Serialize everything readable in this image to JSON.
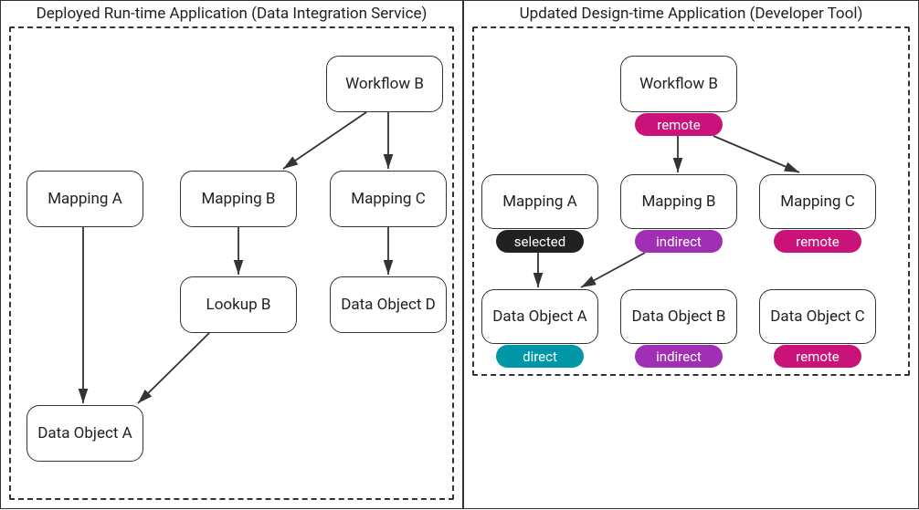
{
  "left": {
    "title": "Deployed Run-time Application (Data Integration Service)",
    "nodes": {
      "workflowB": "Workflow B",
      "mappingA": "Mapping A",
      "mappingB": "Mapping B",
      "mappingC": "Mapping C",
      "lookupB": "Lookup B",
      "dataObjectD": "Data Object D",
      "dataObjectA": "Data Object A"
    }
  },
  "right": {
    "title": "Updated Design-time Application (Developer Tool)",
    "nodes": {
      "workflowB": "Workflow B",
      "mappingA": "Mapping A",
      "mappingB": "Mapping B",
      "mappingC": "Mapping C",
      "dataObjectA": "Data Object A",
      "dataObjectB": "Data Object B",
      "dataObjectC": "Data Object C"
    },
    "badges": {
      "workflowB": "remote",
      "mappingA": "selected",
      "mappingB": "indirect",
      "mappingC": "remote",
      "dataObjectA": "direct",
      "dataObjectB": "indirect",
      "dataObjectC": "remote"
    }
  }
}
